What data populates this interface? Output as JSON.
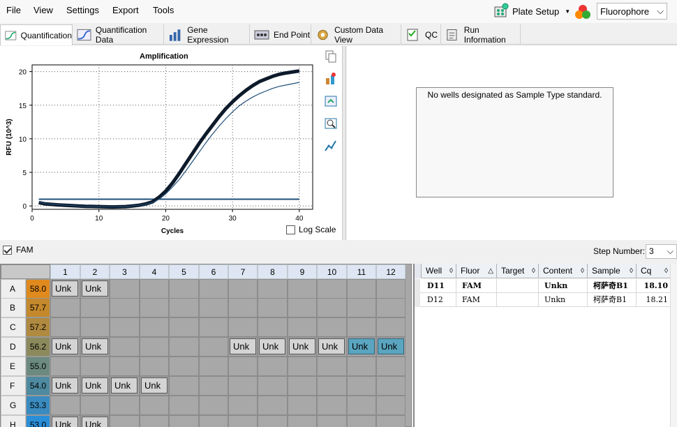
{
  "menu": {
    "items": [
      "File",
      "View",
      "Settings",
      "Export",
      "Tools"
    ]
  },
  "toolbar": {
    "plate_setup_label": "Plate Setup",
    "fluorophore_value": "Fluorophore"
  },
  "tabs": [
    {
      "label": "Quantification",
      "icon": "amplification-curve-icon",
      "active": true
    },
    {
      "label": "Quantification Data",
      "icon": "table-curve-icon"
    },
    {
      "label": "Gene Expression",
      "icon": "bar-chart-icon"
    },
    {
      "label": "End Point",
      "icon": "end-point-icon"
    },
    {
      "label": "Custom Data View",
      "icon": "gear-view-icon"
    },
    {
      "label": "QC",
      "icon": "qc-checklist-icon"
    },
    {
      "label": "Run Information",
      "icon": "run-info-icon"
    }
  ],
  "chart": {
    "log_scale_label": "Log Scale",
    "log_scale_checked": false
  },
  "chart_data": {
    "type": "line",
    "title": "Amplification",
    "xlabel": "Cycles",
    "ylabel": "RFU (10^3)",
    "xlim": [
      0,
      42
    ],
    "ylim": [
      -0.5,
      21
    ],
    "xticks": [
      0,
      10,
      20,
      30,
      40
    ],
    "yticks": [
      0,
      5,
      10,
      15,
      20
    ],
    "grid": true,
    "threshold": 1.0,
    "series": [
      {
        "color": "#0d1a2a",
        "style": "thick",
        "x": [
          1,
          2,
          4,
          6,
          8,
          10,
          12,
          14,
          15,
          16,
          17,
          18,
          19,
          20,
          21,
          22,
          23,
          24,
          25,
          26,
          27,
          28,
          29,
          30,
          31,
          32,
          33,
          34,
          35,
          36,
          37,
          38,
          39,
          40
        ],
        "y": [
          0.5,
          0.3,
          0.15,
          0.05,
          -0.05,
          -0.1,
          -0.15,
          -0.1,
          0.0,
          0.1,
          0.3,
          0.6,
          1.3,
          2.2,
          3.4,
          4.8,
          6.3,
          7.8,
          9.3,
          10.7,
          12.0,
          13.3,
          14.5,
          15.5,
          16.4,
          17.2,
          17.9,
          18.5,
          18.9,
          19.3,
          19.6,
          19.8,
          19.95,
          20.1
        ]
      },
      {
        "color": "#1f4e79",
        "style": "thin",
        "x": [
          1,
          2,
          4,
          6,
          8,
          10,
          12,
          14,
          15,
          16,
          17,
          18,
          19,
          20,
          21,
          22,
          23,
          24,
          25,
          26,
          27,
          28,
          29,
          30,
          31,
          32,
          33,
          34,
          35,
          36,
          37,
          38,
          39,
          40
        ],
        "y": [
          0.6,
          0.35,
          0.2,
          0.05,
          -0.05,
          -0.1,
          -0.12,
          -0.1,
          0.0,
          0.1,
          0.25,
          0.5,
          1.0,
          1.8,
          2.8,
          3.9,
          5.2,
          6.6,
          8.0,
          9.4,
          10.7,
          11.9,
          13.0,
          14.0,
          14.9,
          15.6,
          16.2,
          16.7,
          17.1,
          17.5,
          17.8,
          18.0,
          18.2,
          18.4
        ]
      }
    ]
  },
  "right_panel": {
    "message": "No wells designated as Sample Type standard."
  },
  "fam": {
    "label": "FAM",
    "checked": true
  },
  "step": {
    "label": "Step Number:",
    "value": "3"
  },
  "plate": {
    "columns": [
      "1",
      "2",
      "3",
      "4",
      "5",
      "6",
      "7",
      "8",
      "9",
      "10",
      "11",
      "12"
    ],
    "rows": [
      {
        "label": "A",
        "temp": "58.0",
        "color": "#e08a1e",
        "wells": [
          "Unk",
          "Unk",
          "",
          "",
          "",
          "",
          "",
          "",
          "",
          "",
          "",
          ""
        ]
      },
      {
        "label": "B",
        "temp": "57.7",
        "color": "#c4892c",
        "wells": [
          "",
          "",
          "",
          "",
          "",
          "",
          "",
          "",
          "",
          "",
          "",
          ""
        ]
      },
      {
        "label": "C",
        "temp": "57.2",
        "color": "#b08a40",
        "wells": [
          "",
          "",
          "",
          "",
          "",
          "",
          "",
          "",
          "",
          "",
          "",
          ""
        ]
      },
      {
        "label": "D",
        "temp": "56.2",
        "color": "#8c8a5c",
        "wells": [
          "Unk",
          "Unk",
          "",
          "",
          "",
          "",
          "Unk",
          "Unk",
          "Unk",
          "Unk",
          "Unk",
          "Unk"
        ]
      },
      {
        "label": "E",
        "temp": "55.0",
        "color": "#6c8a80",
        "wells": [
          "",
          "",
          "",
          "",
          "",
          "",
          "",
          "",
          "",
          "",
          "",
          ""
        ]
      },
      {
        "label": "F",
        "temp": "54.0",
        "color": "#4e8aa0",
        "wells": [
          "Unk",
          "Unk",
          "Unk",
          "Unk",
          "",
          "",
          "",
          "",
          "",
          "",
          "",
          ""
        ]
      },
      {
        "label": "G",
        "temp": "53.3",
        "color": "#3a8cc0",
        "wells": [
          "",
          "",
          "",
          "",
          "",
          "",
          "",
          "",
          "",
          "",
          "",
          ""
        ]
      },
      {
        "label": "H",
        "temp": "53.0",
        "color": "#2a8ed8",
        "wells": [
          "Unk",
          "Unk",
          "",
          "",
          "",
          "",
          "",
          "",
          "",
          "",
          "",
          ""
        ]
      }
    ],
    "selected_wells": [
      "D11",
      "D12"
    ]
  },
  "table": {
    "columns": [
      "Well",
      "Fluor",
      "Target",
      "Content",
      "Sample",
      "Cq"
    ],
    "rows": [
      {
        "well": "D11",
        "fluor": "FAM",
        "target": "",
        "content": "Unkn",
        "sample": "柯萨奇B1",
        "cq": "18.10",
        "bold": true
      },
      {
        "well": "D12",
        "fluor": "FAM",
        "target": "",
        "content": "Unkn",
        "sample": "柯萨奇B1",
        "cq": "18.21",
        "bold": false
      }
    ]
  },
  "colors": {
    "curve_main": "#0d1a2a",
    "curve_thin": "#1f4e79",
    "threshold": "#1f4e79",
    "selected_well": "#5aa5bf"
  }
}
